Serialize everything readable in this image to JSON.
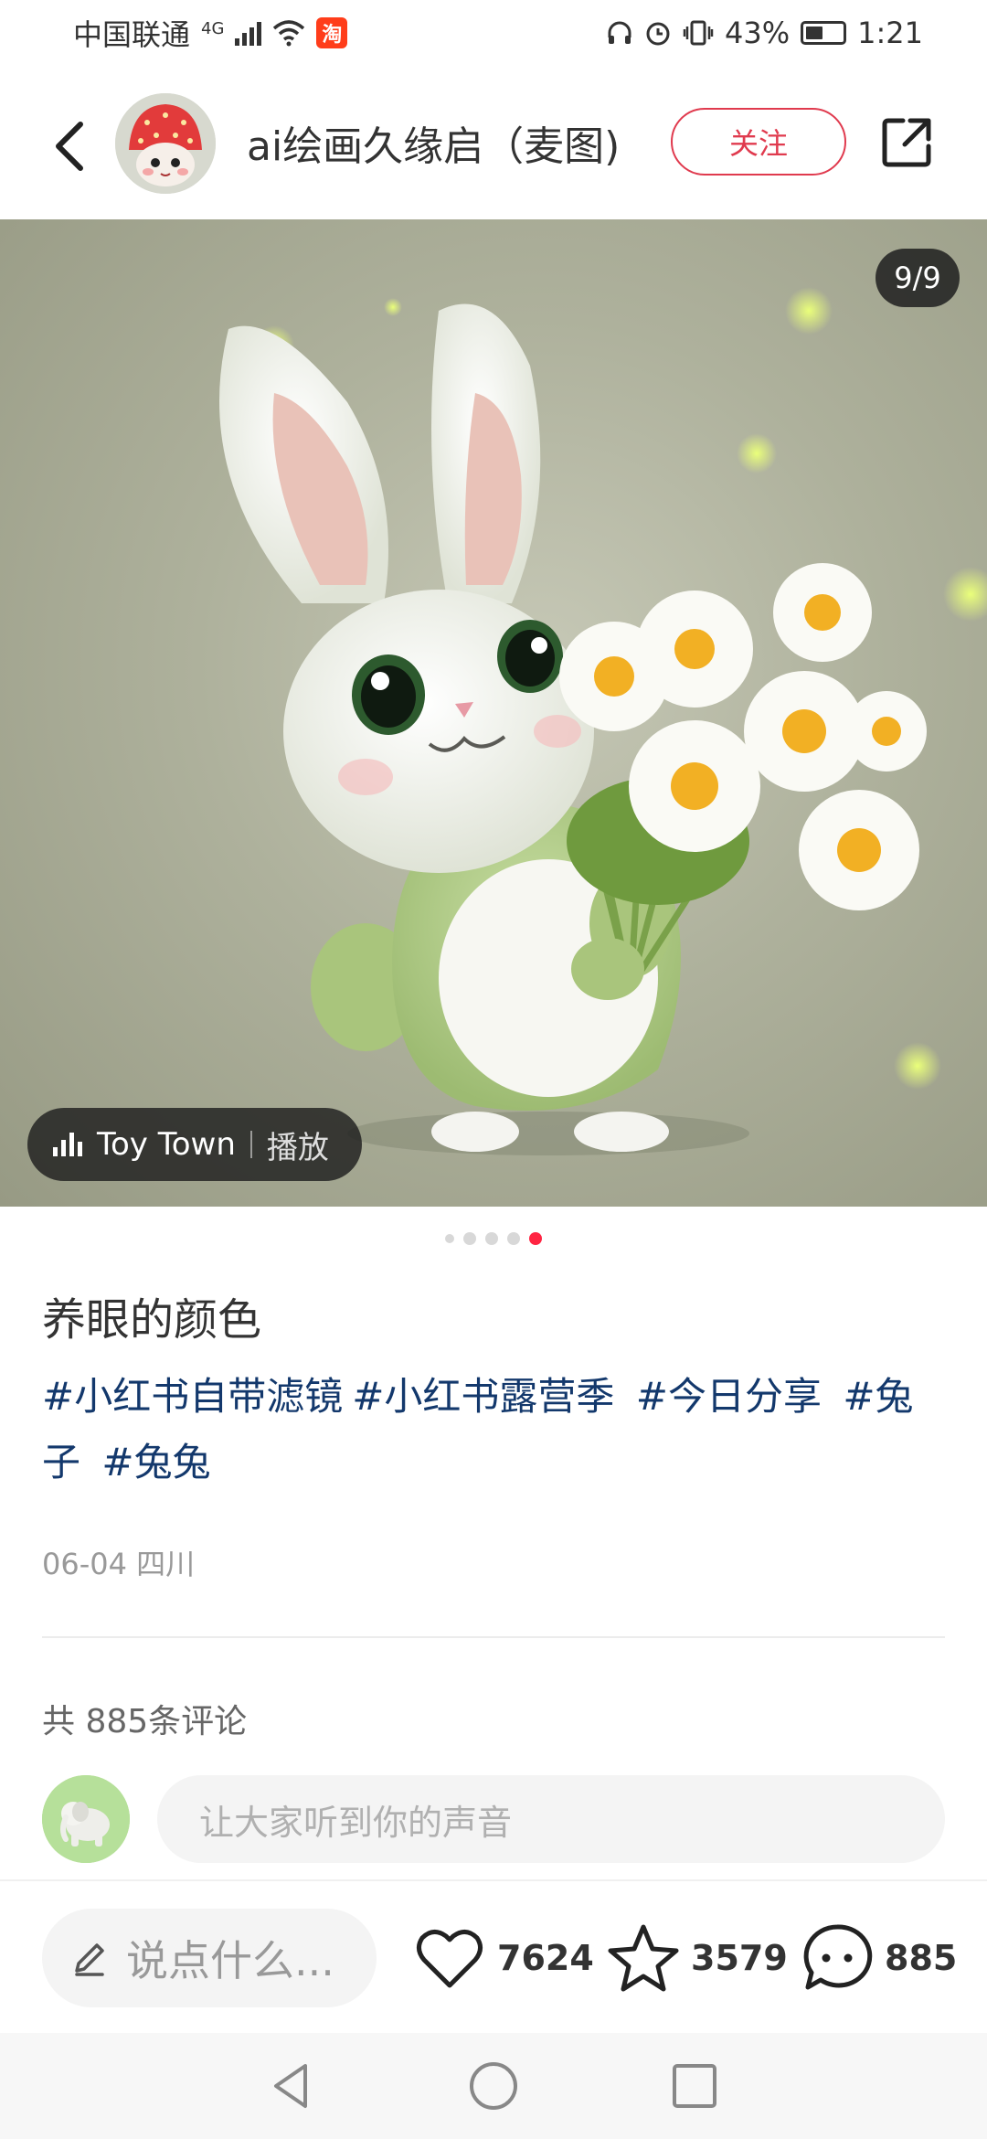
{
  "status_bar": {
    "carrier": "中国联通",
    "network": "4G",
    "taobao_badge": "淘",
    "battery_percent": "43%",
    "time": "1:21",
    "icons": [
      "signal-icon",
      "wifi-icon",
      "headphones-icon",
      "alarm-icon",
      "vibrate-icon",
      "battery-icon"
    ]
  },
  "header": {
    "back_icon": "chevron-left-icon",
    "author_name": "ai绘画久缘启（麦图)",
    "follow_label": "关注",
    "share_icon": "share-external-icon"
  },
  "photo": {
    "page_counter": "9/9",
    "music": {
      "track": "Toy Town",
      "play_label": "播放"
    }
  },
  "carousel": {
    "total_dots": 5,
    "active_index": 4
  },
  "note": {
    "title": "养眼的颜色",
    "tags": [
      "#小红书自带滤镜",
      "#小红书露营季",
      "#今日分享",
      "#兔子",
      "#兔兔"
    ],
    "date_location": "06-04 四川"
  },
  "comments": {
    "count_text": "共 885条评论",
    "input_placeholder": "让大家听到你的声音"
  },
  "action_bar": {
    "say_placeholder": "说点什么...",
    "likes": "7624",
    "collects": "3579",
    "comments": "885"
  },
  "colors": {
    "accent": "#ff2442",
    "follow_red": "#e03a4e",
    "tag_blue": "#13386c"
  }
}
